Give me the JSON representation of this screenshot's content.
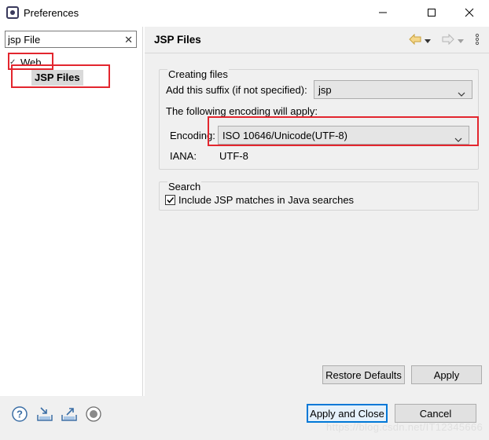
{
  "window": {
    "title": "Preferences",
    "icon": "eclipse-preferences-icon"
  },
  "filter": {
    "value": "jsp File",
    "clear_icon": "clear-icon"
  },
  "tree": {
    "parent": {
      "label": "Web",
      "icon": "chevron-down-icon"
    },
    "child": {
      "label": "JSP Files"
    }
  },
  "page": {
    "title": "JSP Files",
    "nav_icons": [
      "back-arrow-icon",
      "dropdown-icon",
      "forward-arrow-icon",
      "dropdown-icon",
      "menu-icon"
    ]
  },
  "creating_files": {
    "group_title": "Creating files",
    "suffix_label": "Add this suffix (if not specified):",
    "suffix_value": "jsp",
    "encoding_intro": "The following encoding will apply:",
    "encoding_label": "Encoding:",
    "encoding_value": "ISO 10646/Unicode(UTF-8)",
    "iana_label": "IANA:",
    "iana_value": "UTF-8"
  },
  "search": {
    "group_title": "Search",
    "checkbox_label": "Include JSP matches in Java searches",
    "checked": true
  },
  "buttons": {
    "restore_defaults": "Restore Defaults",
    "apply": "Apply",
    "apply_and_close": "Apply and Close",
    "cancel": "Cancel"
  },
  "footer_icons": [
    "help-icon",
    "import-icon",
    "export-icon",
    "record-icon"
  ],
  "watermark": "https://blog.csdn.net/IT12345666",
  "colors": {
    "highlight_red": "#e3262e",
    "primary_button_border": "#0078d7",
    "panel_bg": "#f0f0f0"
  }
}
